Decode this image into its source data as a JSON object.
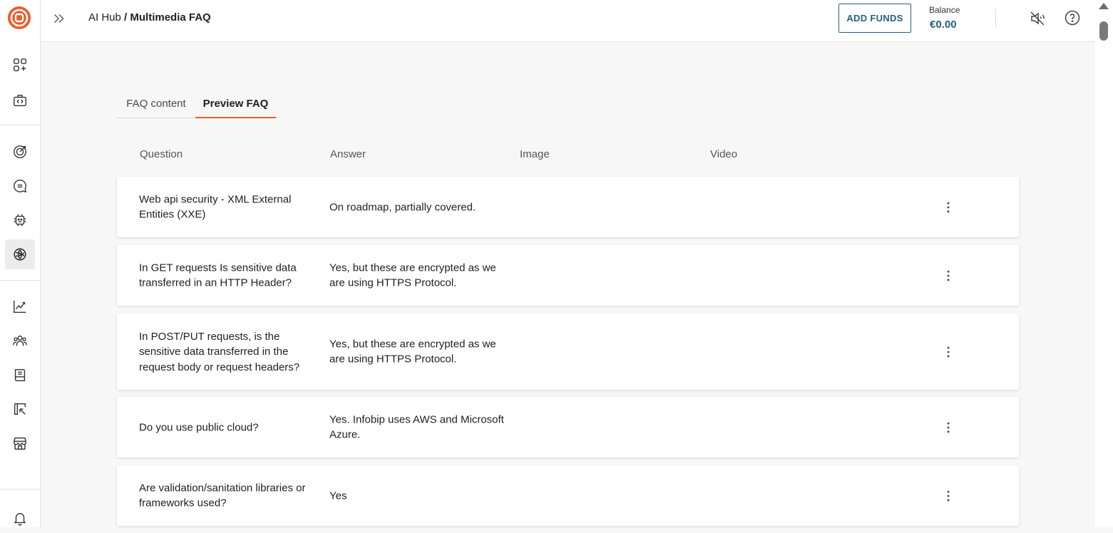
{
  "header": {
    "breadcrumb_root": "AI Hub",
    "breadcrumb_sep": " / ",
    "breadcrumb_current": "Multimedia FAQ",
    "add_funds_label": "ADD FUNDS",
    "balance_label": "Balance",
    "balance_value": "€0.00"
  },
  "colors": {
    "accent": "#e2622c",
    "brand_logo": "#ef5a28",
    "link_dark": "#2b5f7a"
  },
  "sidebar": {
    "items": [
      {
        "icon": "apps-add-icon"
      },
      {
        "icon": "code-briefcase-icon"
      },
      {
        "icon": "target-icon"
      },
      {
        "icon": "chat-icon"
      },
      {
        "icon": "bot-icon"
      },
      {
        "icon": "ai-hub-icon",
        "active": true
      },
      {
        "icon": "analytics-icon"
      },
      {
        "icon": "people-icon"
      },
      {
        "icon": "book-icon"
      },
      {
        "icon": "pointer-icon"
      },
      {
        "icon": "store-icon"
      },
      {
        "icon": "bell-icon"
      }
    ]
  },
  "tabs": [
    {
      "label": "FAQ content",
      "active": false
    },
    {
      "label": "Preview FAQ",
      "active": true
    }
  ],
  "table": {
    "columns": [
      "Question",
      "Answer",
      "Image",
      "Video"
    ],
    "rows": [
      {
        "question": "Web api security - XML External Entities (XXE)",
        "answer": "On roadmap, partially covered."
      },
      {
        "question": "In GET requests Is sensitive data transferred in an HTTP Header?",
        "answer": "Yes, but these are encrypted as we are using HTTPS Protocol."
      },
      {
        "question": "In POST/PUT requests, is the sensitive data transferred in the request body or request headers?",
        "answer": "Yes, but these are encrypted as we are using HTTPS Protocol."
      },
      {
        "question": "Do you use public cloud?",
        "answer": "Yes. Infobip uses AWS and Microsoft Azure."
      },
      {
        "question": "Are validation/sanitation libraries or frameworks used?",
        "answer": "Yes"
      }
    ]
  }
}
